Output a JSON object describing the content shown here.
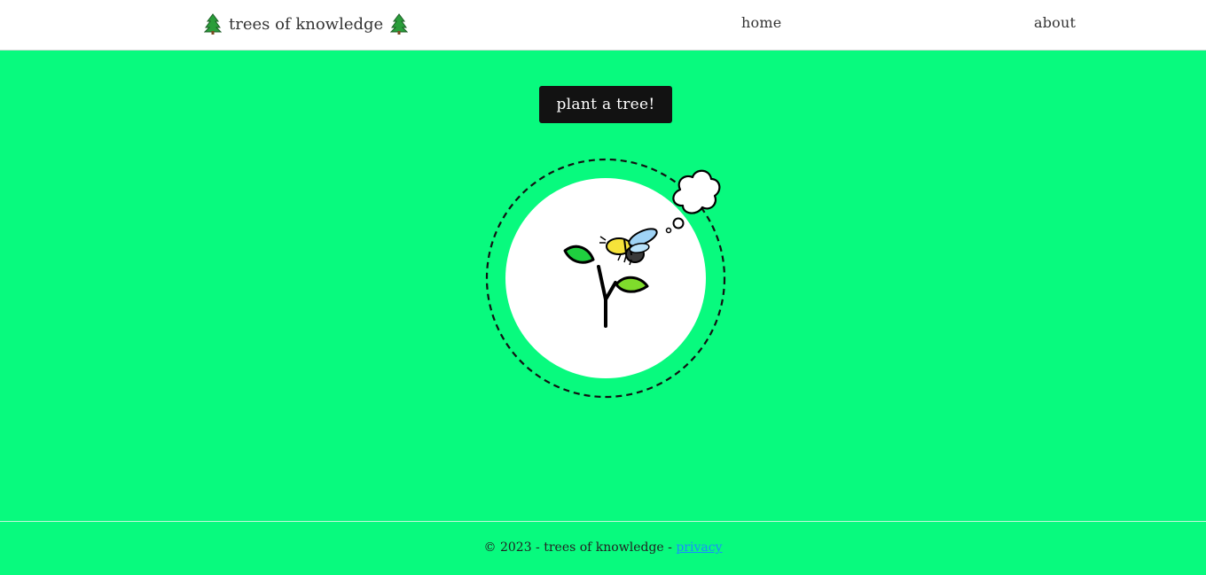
{
  "header": {
    "brand_label": "trees of knowledge",
    "brand_icon_left": "evergreen-tree-icon",
    "brand_icon_right": "evergreen-tree-icon",
    "nav": [
      {
        "label": "home"
      },
      {
        "label": "about"
      }
    ]
  },
  "main": {
    "plant_button_label": "plant a tree!",
    "illustration": {
      "icons": [
        "sapling-icon",
        "bee-icon",
        "thought-bubble-icon"
      ]
    }
  },
  "footer": {
    "copyright": "© 2023 - trees of knowledge - ",
    "privacy_label": "privacy"
  },
  "colors": {
    "background": "#08fa7e",
    "header": "#ffffff",
    "button": "#121212",
    "leaf": "#1fcf3f",
    "bee_body": "#f6e33a",
    "bee_wing": "#9fd3f5",
    "link": "#1a8cff"
  }
}
